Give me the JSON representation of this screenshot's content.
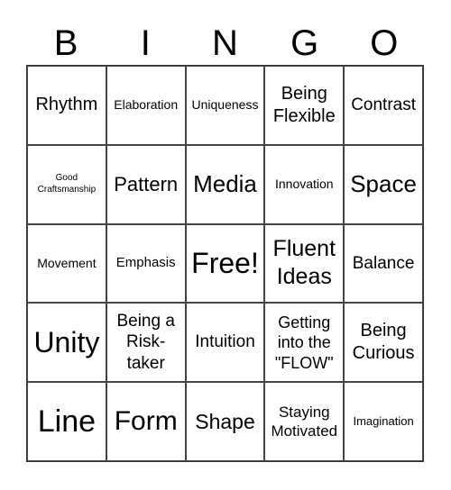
{
  "header": [
    "B",
    "I",
    "N",
    "G",
    "O"
  ],
  "cells": [
    {
      "text": "Rhythm",
      "size": 20
    },
    {
      "text": "Elaboration",
      "size": 14
    },
    {
      "text": "Uniqueness",
      "size": 14
    },
    {
      "text": "Being Flexible",
      "size": 20
    },
    {
      "text": "Contrast",
      "size": 19
    },
    {
      "text": "Good Craftsmanship",
      "size": 10
    },
    {
      "text": "Pattern",
      "size": 22
    },
    {
      "text": "Media",
      "size": 26
    },
    {
      "text": "Innovation",
      "size": 14
    },
    {
      "text": "Space",
      "size": 26
    },
    {
      "text": "Movement",
      "size": 14
    },
    {
      "text": "Emphasis",
      "size": 15
    },
    {
      "text": "Free!",
      "size": 32
    },
    {
      "text": "Fluent Ideas",
      "size": 25
    },
    {
      "text": "Balance",
      "size": 19
    },
    {
      "text": "Unity",
      "size": 32
    },
    {
      "text": "Being a Risk-taker",
      "size": 19
    },
    {
      "text": "Intuition",
      "size": 19
    },
    {
      "text": "Getting into the \"FLOW\"",
      "size": 18
    },
    {
      "text": "Being Curious",
      "size": 20
    },
    {
      "text": "Line",
      "size": 34
    },
    {
      "text": "Form",
      "size": 30
    },
    {
      "text": "Shape",
      "size": 23
    },
    {
      "text": "Staying Motivated",
      "size": 17
    },
    {
      "text": "Imagination",
      "size": 13
    }
  ]
}
